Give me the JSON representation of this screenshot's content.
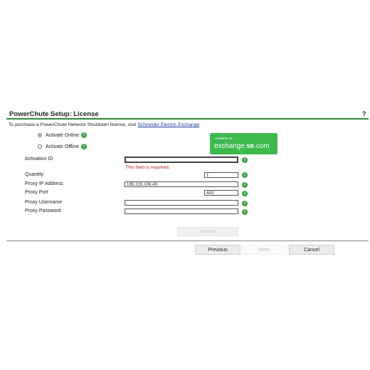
{
  "page": {
    "title": "PowerChute Setup: License",
    "help": "?",
    "intro_text": "To purchase a PowerChute Network Shutdown license, visit ",
    "intro_link": "Schneider Electric Exchange",
    "intro_end": "."
  },
  "activation": {
    "online_label": "Activate Online",
    "offline_label": "Activate Offline",
    "selected": "online"
  },
  "banner": {
    "small": "Available on",
    "domain_prefix": "exchange.",
    "domain_bold": "se",
    "domain_suffix": ".com",
    "color": "#3dba4e"
  },
  "form": {
    "activation_id": {
      "label": "Activation ID",
      "value": "",
      "error": "This field is required."
    },
    "quantity": {
      "label": "Quantity",
      "value": "1"
    },
    "proxy_ip": {
      "label": "Proxy IP Address",
      "value": "165.225.106.40"
    },
    "proxy_port": {
      "label": "Proxy Port",
      "value": "443"
    },
    "proxy_username": {
      "label": "Proxy Username",
      "value": ""
    },
    "proxy_password": {
      "label": "Proxy Password",
      "value": ""
    },
    "activate_label": "Activate"
  },
  "nav": {
    "previous": "Previous",
    "next": "Next",
    "cancel": "Cancel"
  },
  "icons": {
    "info": "info-icon",
    "info_glyph": "i"
  },
  "colors": {
    "accent": "#2e8b3d",
    "error": "#b22222",
    "link": "#1a3c9c"
  }
}
